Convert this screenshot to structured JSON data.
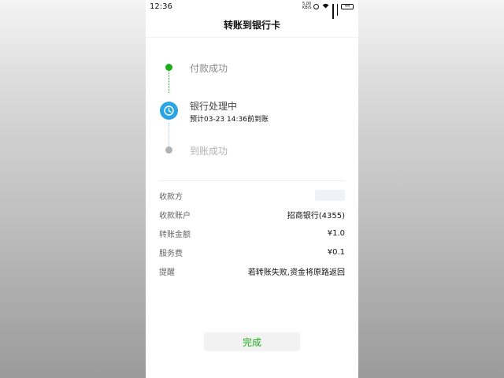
{
  "status_bar": {
    "time": "12:36",
    "speed_top": "5.00",
    "speed_bottom": "KB/S",
    "battery": "44"
  },
  "header": {
    "title": "转账到银行卡"
  },
  "timeline": {
    "steps": [
      {
        "label": "付款成功",
        "state": "done",
        "color": "#1aad19"
      },
      {
        "label": "银行处理中",
        "sub": "预计03-23 14:36前到账",
        "state": "processing",
        "color": "#2aa4e2"
      },
      {
        "label": "到账成功",
        "state": "pending",
        "color": "#b2b2b2"
      }
    ]
  },
  "details": {
    "rows": [
      {
        "key": "收款方",
        "value": ""
      },
      {
        "key": "收款账户",
        "value": "招商银行(4355)"
      },
      {
        "key": "转账金额",
        "value": "¥1.0"
      },
      {
        "key": "服务费",
        "value": "¥0.1"
      },
      {
        "key": "提醒",
        "value": "若转账失败,资金将原路返回"
      }
    ]
  },
  "footer": {
    "done_label": "完成"
  },
  "icons": [
    "alarm-icon",
    "wifi-icon",
    "signal-icon",
    "battery-icon",
    "clock-icon"
  ]
}
